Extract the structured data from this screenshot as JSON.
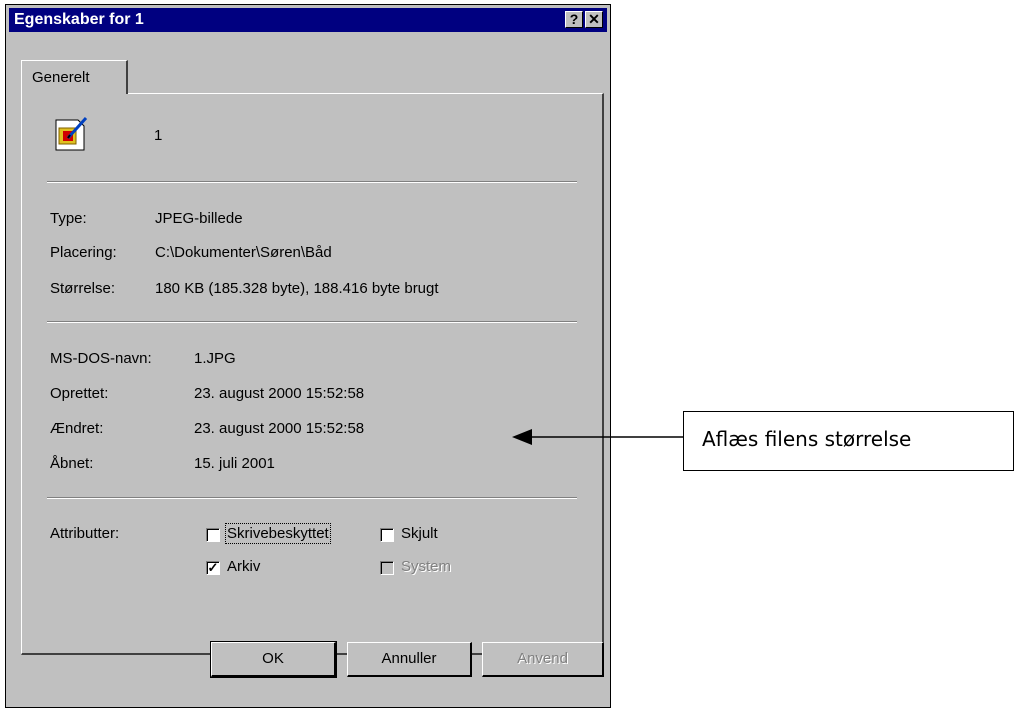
{
  "window": {
    "title": "Egenskaber for 1",
    "help_label": "?",
    "close_label": "✕"
  },
  "tabs": [
    {
      "label": "Generelt"
    }
  ],
  "file": {
    "name": "1",
    "icon": "jpeg-image-file-icon"
  },
  "details": [
    {
      "label": "Type:",
      "value": "JPEG-billede"
    },
    {
      "label": "Placering:",
      "value": "C:\\Dokumenter\\Søren\\Båd"
    },
    {
      "label": "Størrelse:",
      "value": "180 KB (185.328 byte), 188.416 byte brugt"
    }
  ],
  "dates": [
    {
      "label": "MS-DOS-navn:",
      "value": "1.JPG"
    },
    {
      "label": "Oprettet:",
      "value": "23. august 2000 15:52:58"
    },
    {
      "label": "Ændret:",
      "value": "23. august 2000 15:52:58"
    },
    {
      "label": "Åbnet:",
      "value": "15. juli 2001"
    }
  ],
  "attributes": {
    "label": "Attributter:",
    "items": [
      {
        "label": "Skrivebeskyttet",
        "checked": false,
        "enabled": true
      },
      {
        "label": "Skjult",
        "checked": false,
        "enabled": true
      },
      {
        "label": "Arkiv",
        "checked": true,
        "enabled": true
      },
      {
        "label": "System",
        "checked": false,
        "enabled": false
      }
    ]
  },
  "buttons": {
    "ok": "OK",
    "cancel": "Annuller",
    "apply": "Anvend"
  },
  "annotation": {
    "text": "Aflæs filens størrelse"
  },
  "colors": {
    "titlebar": "#000080",
    "dialog": "#c0c0c0"
  }
}
